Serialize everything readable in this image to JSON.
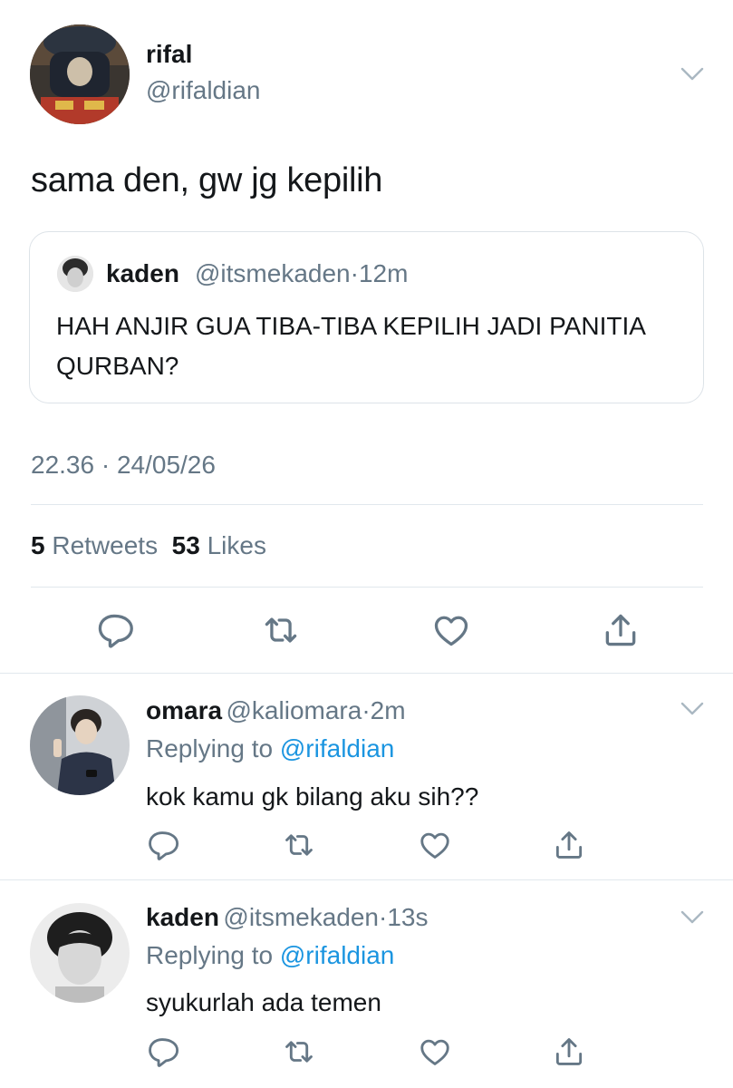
{
  "main_tweet": {
    "name": "rifal",
    "handle": "@rifaldian",
    "text": "sama den, gw jg kepilih",
    "quoted": {
      "name": "kaden",
      "handle": "@itsmekaden",
      "time": "12m",
      "text": "HAH ANJIR GUA TIBA-TIBA KEPILIH JADI PANITIA QURBAN?"
    },
    "timestamp": "22.36 · 24/05/26",
    "stats": {
      "retweets_count": "5",
      "retweets_label": "Retweets",
      "likes_count": "53",
      "likes_label": "Likes"
    }
  },
  "replies": [
    {
      "name": "omara",
      "handle": "@kaliomara",
      "time": "2m",
      "replying_label": "Replying to",
      "replying_to": "@rifaldian",
      "text": "kok kamu gk bilang aku sih??"
    },
    {
      "name": "kaden",
      "handle": "@itsmekaden",
      "time": "13s",
      "replying_label": "Replying to",
      "replying_to": "@rifaldian",
      "text": "syukurlah ada temen"
    }
  ],
  "separator": "·",
  "icons": {
    "reply": "reply-icon",
    "retweet": "retweet-icon",
    "like": "heart-icon",
    "share": "share-icon",
    "more": "chevron-down-icon"
  },
  "colors": {
    "text": "#14171a",
    "secondary": "#657786",
    "link": "#1b95e0",
    "border": "#e1e8ed"
  }
}
